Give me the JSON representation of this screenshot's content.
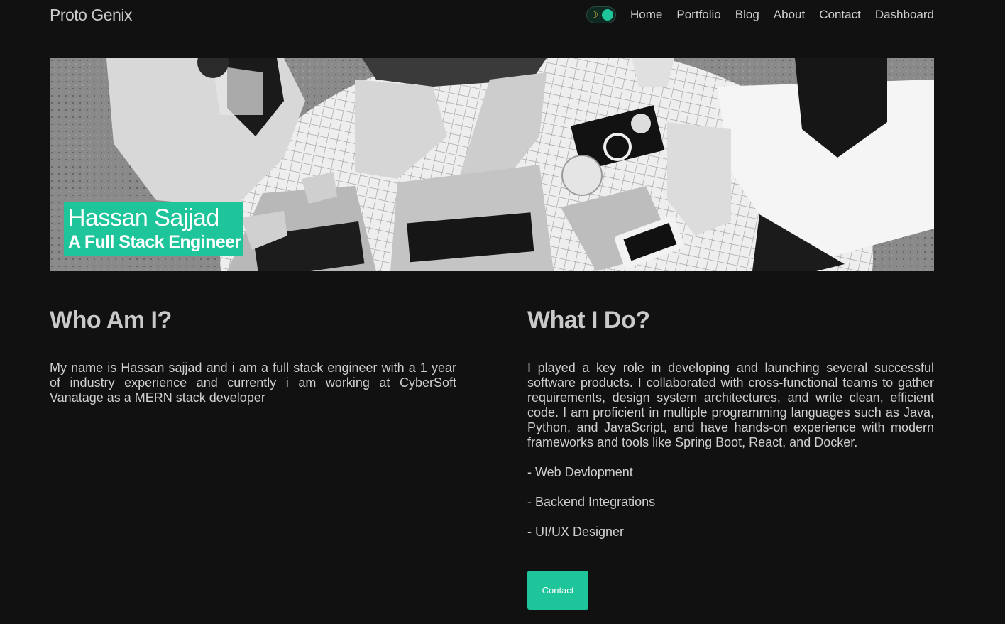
{
  "header": {
    "logo": "Proto Genix",
    "theme_toggle_icon": "moon-icon",
    "nav": [
      "Home",
      "Portfolio",
      "Blog",
      "About",
      "Contact",
      "Dashboard"
    ]
  },
  "hero": {
    "name": "Hassan Sajjad",
    "role": "A Full Stack Engineer"
  },
  "who": {
    "title": "Who Am I?",
    "text": "My name is Hassan sajjad and i am a full stack engineer with a 1 year of industry experience and currently i am working at CyberSoft Vanatage as a MERN stack developer"
  },
  "what": {
    "title": "What I Do?",
    "text": "I played a key role in developing and launching several successful software products. I collaborated with cross-functional teams to gather requirements, design system architectures, and write clean, efficient code. I am proficient in multiple programming languages such as Java, Python, and JavaScript, and have hands-on experience with modern frameworks and tools like Spring Boot, React, and Docker.",
    "skills": [
      "- Web Devlopment",
      "- Backend Integrations",
      "- UI/UX Designer"
    ],
    "button": "Contact"
  },
  "colors": {
    "accent": "#1fc59a",
    "background": "#111111",
    "text": "#d6d6d6"
  }
}
